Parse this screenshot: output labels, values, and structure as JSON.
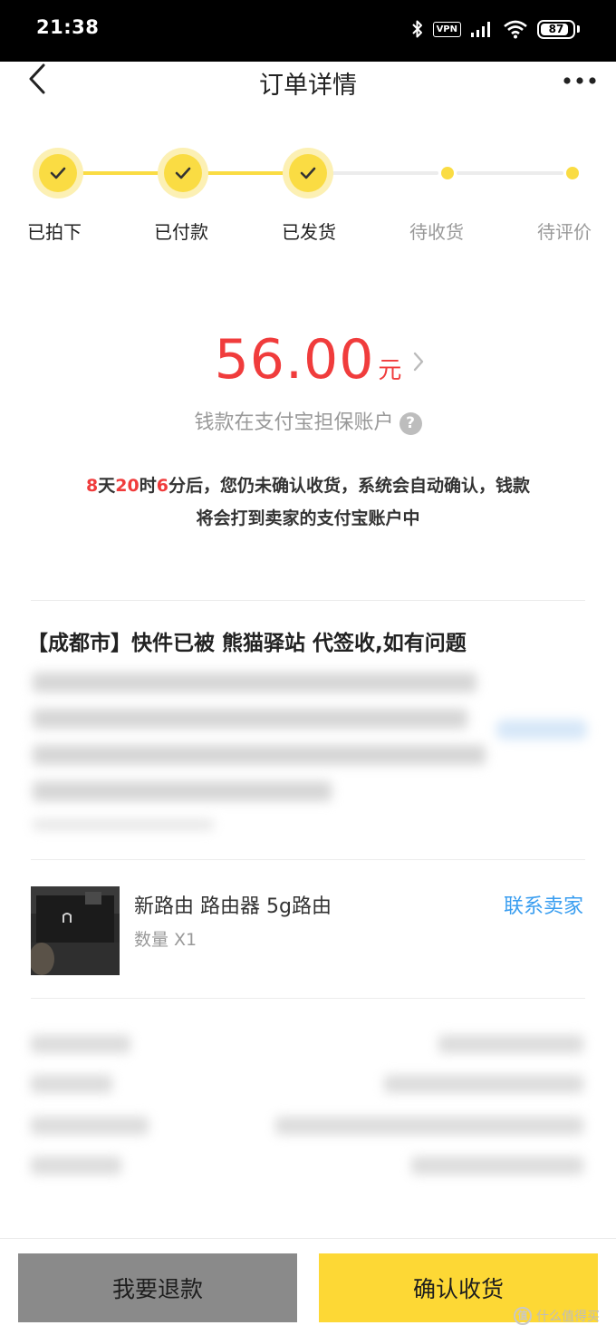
{
  "status_bar": {
    "time": "21:38",
    "vpn": "VPN",
    "battery": "87",
    "battery_level": 0.87,
    "icons": [
      "bluetooth-icon",
      "vpn-icon",
      "signal-icon",
      "wifi-icon",
      "battery-icon"
    ]
  },
  "nav": {
    "title": "订单详情",
    "back_icon": "chevron-left-icon",
    "more_icon": "more-dots-icon"
  },
  "steps": [
    {
      "label": "已拍下",
      "done": true
    },
    {
      "label": "已付款",
      "done": true
    },
    {
      "label": "已发货",
      "done": true
    },
    {
      "label": "待收货",
      "done": false
    },
    {
      "label": "待评价",
      "done": false
    }
  ],
  "colors": {
    "accent_yellow": "#fadc43",
    "price_red": "#f03c3c",
    "link_blue": "#3a9ef0",
    "refund_gray": "#8a8a8a"
  },
  "amount": {
    "value": "56.00",
    "unit": "元",
    "escrow_text": "钱款在支付宝担保账户",
    "help": "?"
  },
  "notice": {
    "days": "8",
    "days_unit": "天",
    "hours": "20",
    "hours_unit": "时",
    "minutes": "6",
    "line1_rest": "分后，您仍未确认收货，系统会自动确认，钱款",
    "line2": "将会打到卖家的支付宝账户中"
  },
  "logistics": {
    "title": "【成都市】快件已被  熊猫驿站  代签收,如有问题"
  },
  "product": {
    "name": "新路由 路由器 5g路由",
    "quantity": "数量 X1",
    "contact": "联系卖家"
  },
  "actions": {
    "refund": "我要退款",
    "confirm": "确认收货"
  },
  "watermark": {
    "badge": "值",
    "text": "什么值得买"
  }
}
